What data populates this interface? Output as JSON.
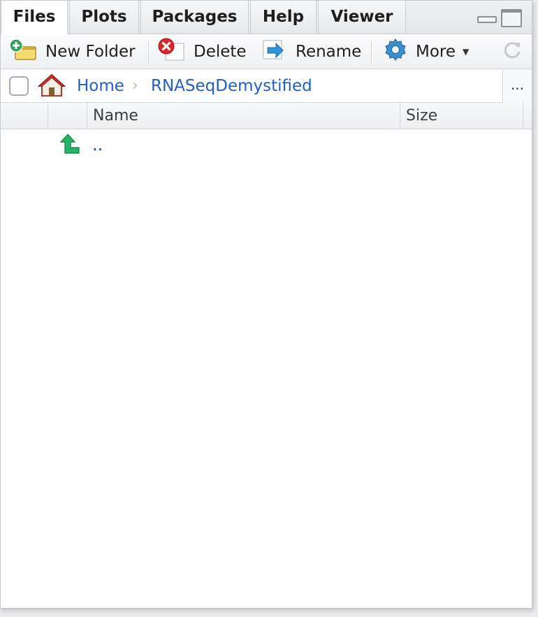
{
  "tabs": [
    {
      "label": "Files",
      "active": true
    },
    {
      "label": "Plots",
      "active": false
    },
    {
      "label": "Packages",
      "active": false
    },
    {
      "label": "Help",
      "active": false
    },
    {
      "label": "Viewer",
      "active": false
    }
  ],
  "toolbar": {
    "new_folder": "New Folder",
    "delete": "Delete",
    "rename": "Rename",
    "more": "More"
  },
  "breadcrumb": {
    "home": "Home",
    "current": "RNASeqDemystified",
    "overflow": "..."
  },
  "table": {
    "columns": [
      "Name",
      "Size"
    ],
    "rows": [
      {
        "name": "..",
        "type": "parent-directory"
      }
    ]
  },
  "icons": {
    "new_folder": "folder-plus-icon",
    "delete": "delete-x-icon",
    "rename": "rename-arrow-icon",
    "more": "gear-icon",
    "refresh": "refresh-icon",
    "home": "home-icon",
    "up": "up-arrow-icon"
  },
  "colors": {
    "link": "#1f5fbf",
    "up_arrow": "#27b36b",
    "delete_red": "#d8262b",
    "gear_blue": "#3b8fd0"
  }
}
